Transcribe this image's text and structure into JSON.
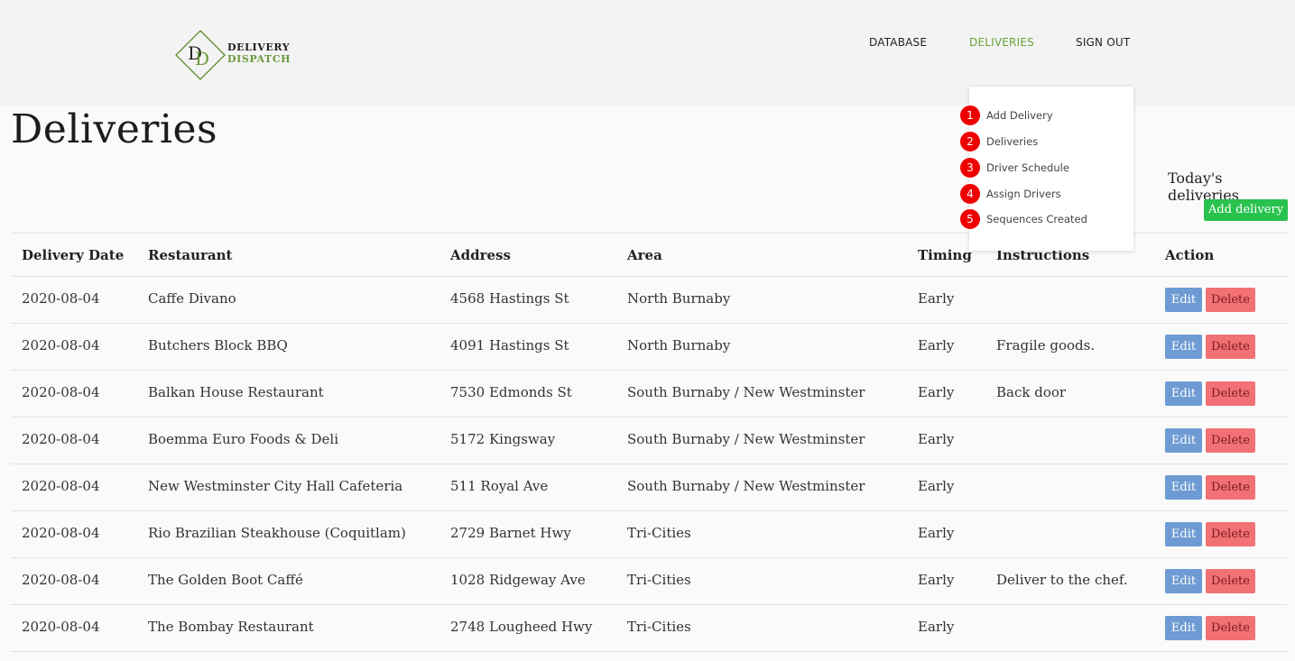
{
  "brand": {
    "line1": "DELIVERY",
    "line2": "DISPATCH",
    "mono1": "D",
    "mono2": "D"
  },
  "nav": {
    "database": "DATABASE",
    "deliveries": "DELIVERIES",
    "sign_out": "SIGN OUT"
  },
  "dropdown": [
    {
      "num": "1",
      "label": "Add Delivery"
    },
    {
      "num": "2",
      "label": "Deliveries"
    },
    {
      "num": "3",
      "label": "Driver Schedule"
    },
    {
      "num": "4",
      "label": "Assign Drivers"
    },
    {
      "num": "5",
      "label": "Sequences Created"
    }
  ],
  "page": {
    "title": "Deliveries",
    "colon": ":",
    "today_label": "Today's deliveries",
    "add_button": "Add delivery"
  },
  "table": {
    "headers": {
      "date": "Delivery Date",
      "restaurant": "Restaurant",
      "address": "Address",
      "area": "Area",
      "timing": "Timing",
      "instructions": "Instructions",
      "action": "Action"
    },
    "edit_label": "Edit",
    "delete_label": "Delete",
    "rows": [
      {
        "date": "2020-08-04",
        "restaurant": "Caffe Divano",
        "address": "4568 Hastings St",
        "area": "North Burnaby",
        "timing": "Early",
        "instructions": ""
      },
      {
        "date": "2020-08-04",
        "restaurant": "Butchers Block BBQ",
        "address": "4091 Hastings St",
        "area": "North Burnaby",
        "timing": "Early",
        "instructions": "Fragile goods."
      },
      {
        "date": "2020-08-04",
        "restaurant": "Balkan House Restaurant",
        "address": "7530 Edmonds St",
        "area": "South Burnaby / New Westminster",
        "timing": "Early",
        "instructions": "Back door"
      },
      {
        "date": "2020-08-04",
        "restaurant": "Boemma Euro Foods & Deli",
        "address": "5172 Kingsway",
        "area": "South Burnaby / New Westminster",
        "timing": "Early",
        "instructions": ""
      },
      {
        "date": "2020-08-04",
        "restaurant": "New Westminster City Hall Cafeteria",
        "address": "511 Royal Ave",
        "area": "South Burnaby / New Westminster",
        "timing": "Early",
        "instructions": ""
      },
      {
        "date": "2020-08-04",
        "restaurant": "Rio Brazilian Steakhouse (Coquitlam)",
        "address": "2729 Barnet Hwy",
        "area": "Tri-Cities",
        "timing": "Early",
        "instructions": ""
      },
      {
        "date": "2020-08-04",
        "restaurant": "The Golden Boot Caffé",
        "address": "1028 Ridgeway Ave",
        "area": "Tri-Cities",
        "timing": "Early",
        "instructions": "Deliver to the chef."
      },
      {
        "date": "2020-08-04",
        "restaurant": "The Bombay Restaurant",
        "address": "2748 Lougheed Hwy",
        "area": "Tri-Cities",
        "timing": "Early",
        "instructions": ""
      }
    ]
  },
  "colors": {
    "accent": "#6aa33a",
    "add_button": "#29c24e",
    "edit_button": "#6e9bd3",
    "delete_button": "#f27175",
    "badge": "#ee0000"
  }
}
